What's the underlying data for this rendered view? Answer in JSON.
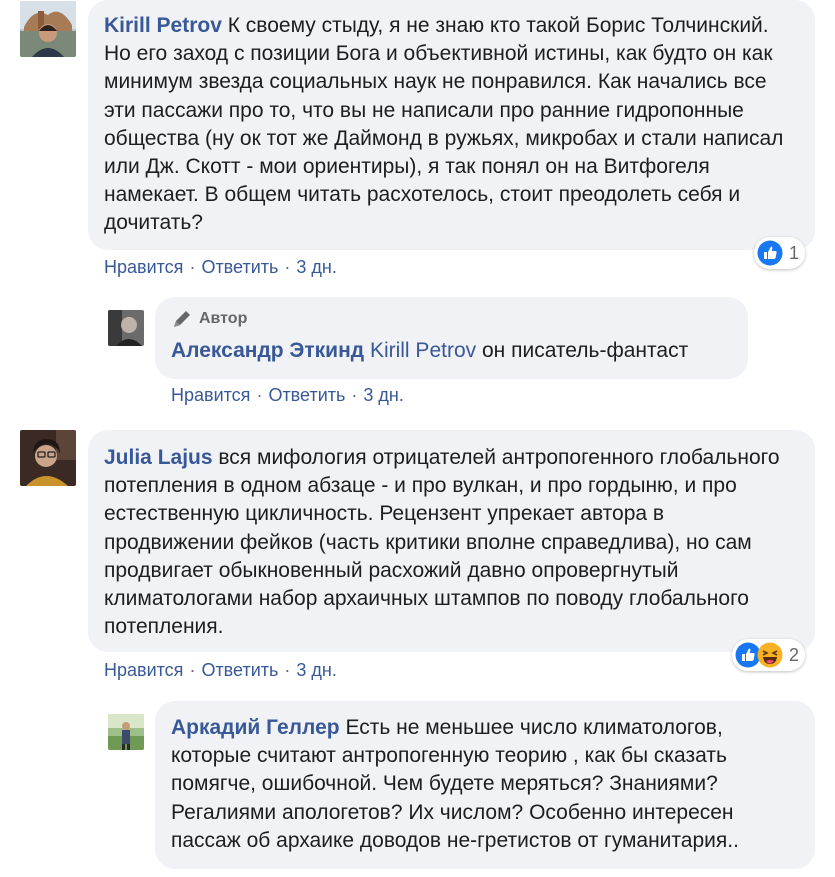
{
  "comments": [
    {
      "author": "Kirill Petrov",
      "text": "К своему стыду, я не знаю кто такой Борис Толчинский. Но его заход с позиции Бога и объективной истины, как будто он как минимум звезда социальных наук не понравился. Как начались все эти пассажи про то, что вы не написали про ранние гидропонные общества (ну ок тот же Даймонд в ружьях, микробах и стали написал или Дж. Скотт - мои ориентиры), я так понял он на Витфогеля намекает. В общем читать расхотелось, стоит преодолеть себя и дочитать?",
      "like": "Нравится",
      "reply": "Ответить",
      "time": "3 дн.",
      "reaction_count": "1",
      "reactions": [
        "like-icon"
      ]
    },
    {
      "badge": "Автор",
      "author": "Александр Эткинд",
      "mention": "Kirill Petrov",
      "text": "он писатель-фантаст",
      "like": "Нравится",
      "reply": "Ответить",
      "time": "3 дн."
    },
    {
      "author": "Julia Lajus",
      "text": "вся мифология отрицателей антропогенного глобального потепления в одном абзаце - и про вулкан, и про гордыню, и про естественную цикличность. Рецензент упрекает автора в продвижении фейков (часть критики вполне справедлива), но сам продвигает обыкновенный расхожий давно опровергнутый климатологами набор архаичных штампов по поводу глобального потепления.",
      "like": "Нравится",
      "reply": "Ответить",
      "time": "3 дн.",
      "reaction_count": "2",
      "reactions": [
        "like-icon",
        "haha-icon"
      ]
    },
    {
      "author": "Аркадий Геллер",
      "text": "Есть не меньшее число климатологов, которые считают антропогенную теорию , как бы сказать помягче, ошибочной. Чем будете меряться? Знаниями? Регалиями апологетов? Их числом? Особенно интересен пассаж об архаике доводов не-гретистов от гуманитария.."
    }
  ],
  "colors": {
    "author": "#385898",
    "bubble": "#f0f2f5",
    "meta": "#65676b",
    "like": "#1877f2",
    "haha": "#f7b125"
  }
}
